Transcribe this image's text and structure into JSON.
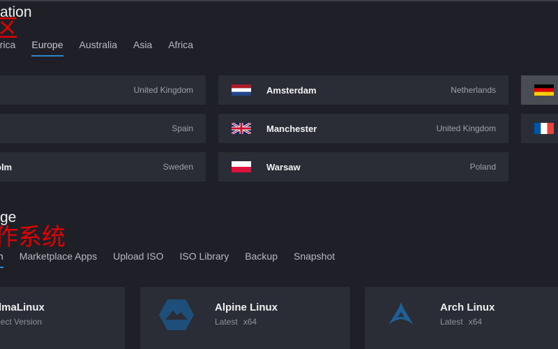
{
  "location": {
    "heading": "ation",
    "annotation": "区",
    "tabs": [
      {
        "label": "America"
      },
      {
        "label": "Europe"
      },
      {
        "label": "Australia"
      },
      {
        "label": "Asia"
      },
      {
        "label": "Africa"
      }
    ],
    "active_tab": "Europe",
    "locations": [
      {
        "city": "",
        "country": "United Kingdom"
      },
      {
        "city": "Amsterdam",
        "country": "Netherlands",
        "flag": "netherlands-flag"
      },
      {
        "city": "",
        "country": "",
        "flag": "germany-flag"
      },
      {
        "city": "",
        "country": "Spain"
      },
      {
        "city": "Manchester",
        "country": "United Kingdom",
        "flag": "uk-flag"
      },
      {
        "city": "",
        "country": "",
        "flag": "france-flag"
      },
      {
        "city": "olm",
        "country": "Sweden"
      },
      {
        "city": "Warsaw",
        "country": "Poland",
        "flag": "poland-flag"
      }
    ]
  },
  "image": {
    "heading": "ge",
    "annotation": "作系统",
    "tabs": [
      {
        "label": "n"
      },
      {
        "label": "Marketplace Apps"
      },
      {
        "label": "Upload ISO"
      },
      {
        "label": "ISO Library"
      },
      {
        "label": "Backup"
      },
      {
        "label": "Snapshot"
      }
    ],
    "active_tab": "n",
    "os_cards": [
      {
        "name": "lmaLinux",
        "version": "lect Version"
      },
      {
        "name": "Alpine Linux",
        "version": "Latest",
        "arch": "x64",
        "icon": "alpine-logo-icon"
      },
      {
        "name": "Arch Linux",
        "version": "Latest",
        "arch": "x64",
        "icon": "arch-logo-icon"
      }
    ]
  },
  "colors": {
    "background": "#1f2027",
    "card": "#2b2d36",
    "accent": "#2c86c9",
    "annotation": "#e00000"
  }
}
